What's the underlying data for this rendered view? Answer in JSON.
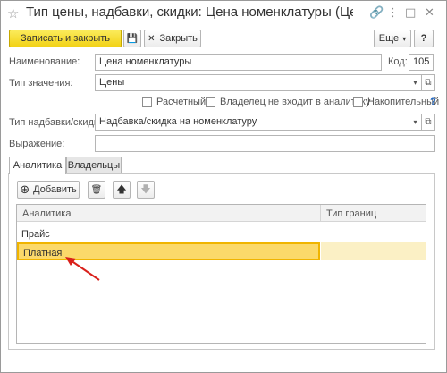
{
  "window": {
    "title": "Тип цены, надбавки, скидки: Цена номенклатуры (Цены,...",
    "star": "☆",
    "link_icon": "🔗",
    "menu_icon": "⋮",
    "maximize_icon": "□",
    "close_icon": "✕"
  },
  "toolbar": {
    "save_close_label": "Записать и закрыть",
    "save_icon": "💾",
    "close_icon": "✕",
    "close_label": "Закрыть",
    "more_label": "Еще",
    "more_arrow": "▾",
    "help": "?"
  },
  "form": {
    "name_label": "Наименование:",
    "name_value": "Цена номенклатуры",
    "code_label": "Код:",
    "code_value": "105",
    "value_type_label": "Тип значения:",
    "value_type_value": "Цены",
    "computed_label": "Расчетный",
    "owner_not_in_analytics_label": "Владелец не входит в аналитику",
    "cumulative_label": "Накопительный",
    "help_mark": "?",
    "surcharge_type_label": "Тип надбавки/скидки:",
    "surcharge_type_value": "Надбавка/скидка на номенклатуру",
    "expression_label": "Выражение:",
    "expression_value": "",
    "dropdown_arrow": "▾",
    "open_icon": "⧉"
  },
  "tabs": [
    {
      "label": "Аналитика"
    },
    {
      "label": "Владельцы"
    }
  ],
  "table_toolbar": {
    "add_icon": "⊕",
    "add_label": "Добавить",
    "delete_icon": "🗑",
    "up_icon": "🡅",
    "down_icon": "🡇"
  },
  "table": {
    "columns": [
      "Аналитика",
      "Тип границ"
    ],
    "rows": [
      {
        "analytics": "Прайс",
        "boundary_type": ""
      },
      {
        "analytics": "Платная",
        "boundary_type": ""
      }
    ]
  },
  "colors": {
    "accent_yellow": "#f2d216",
    "selection": "#fbd96a",
    "arrow_red": "#d9201b",
    "help_blue": "#1a63c2"
  }
}
